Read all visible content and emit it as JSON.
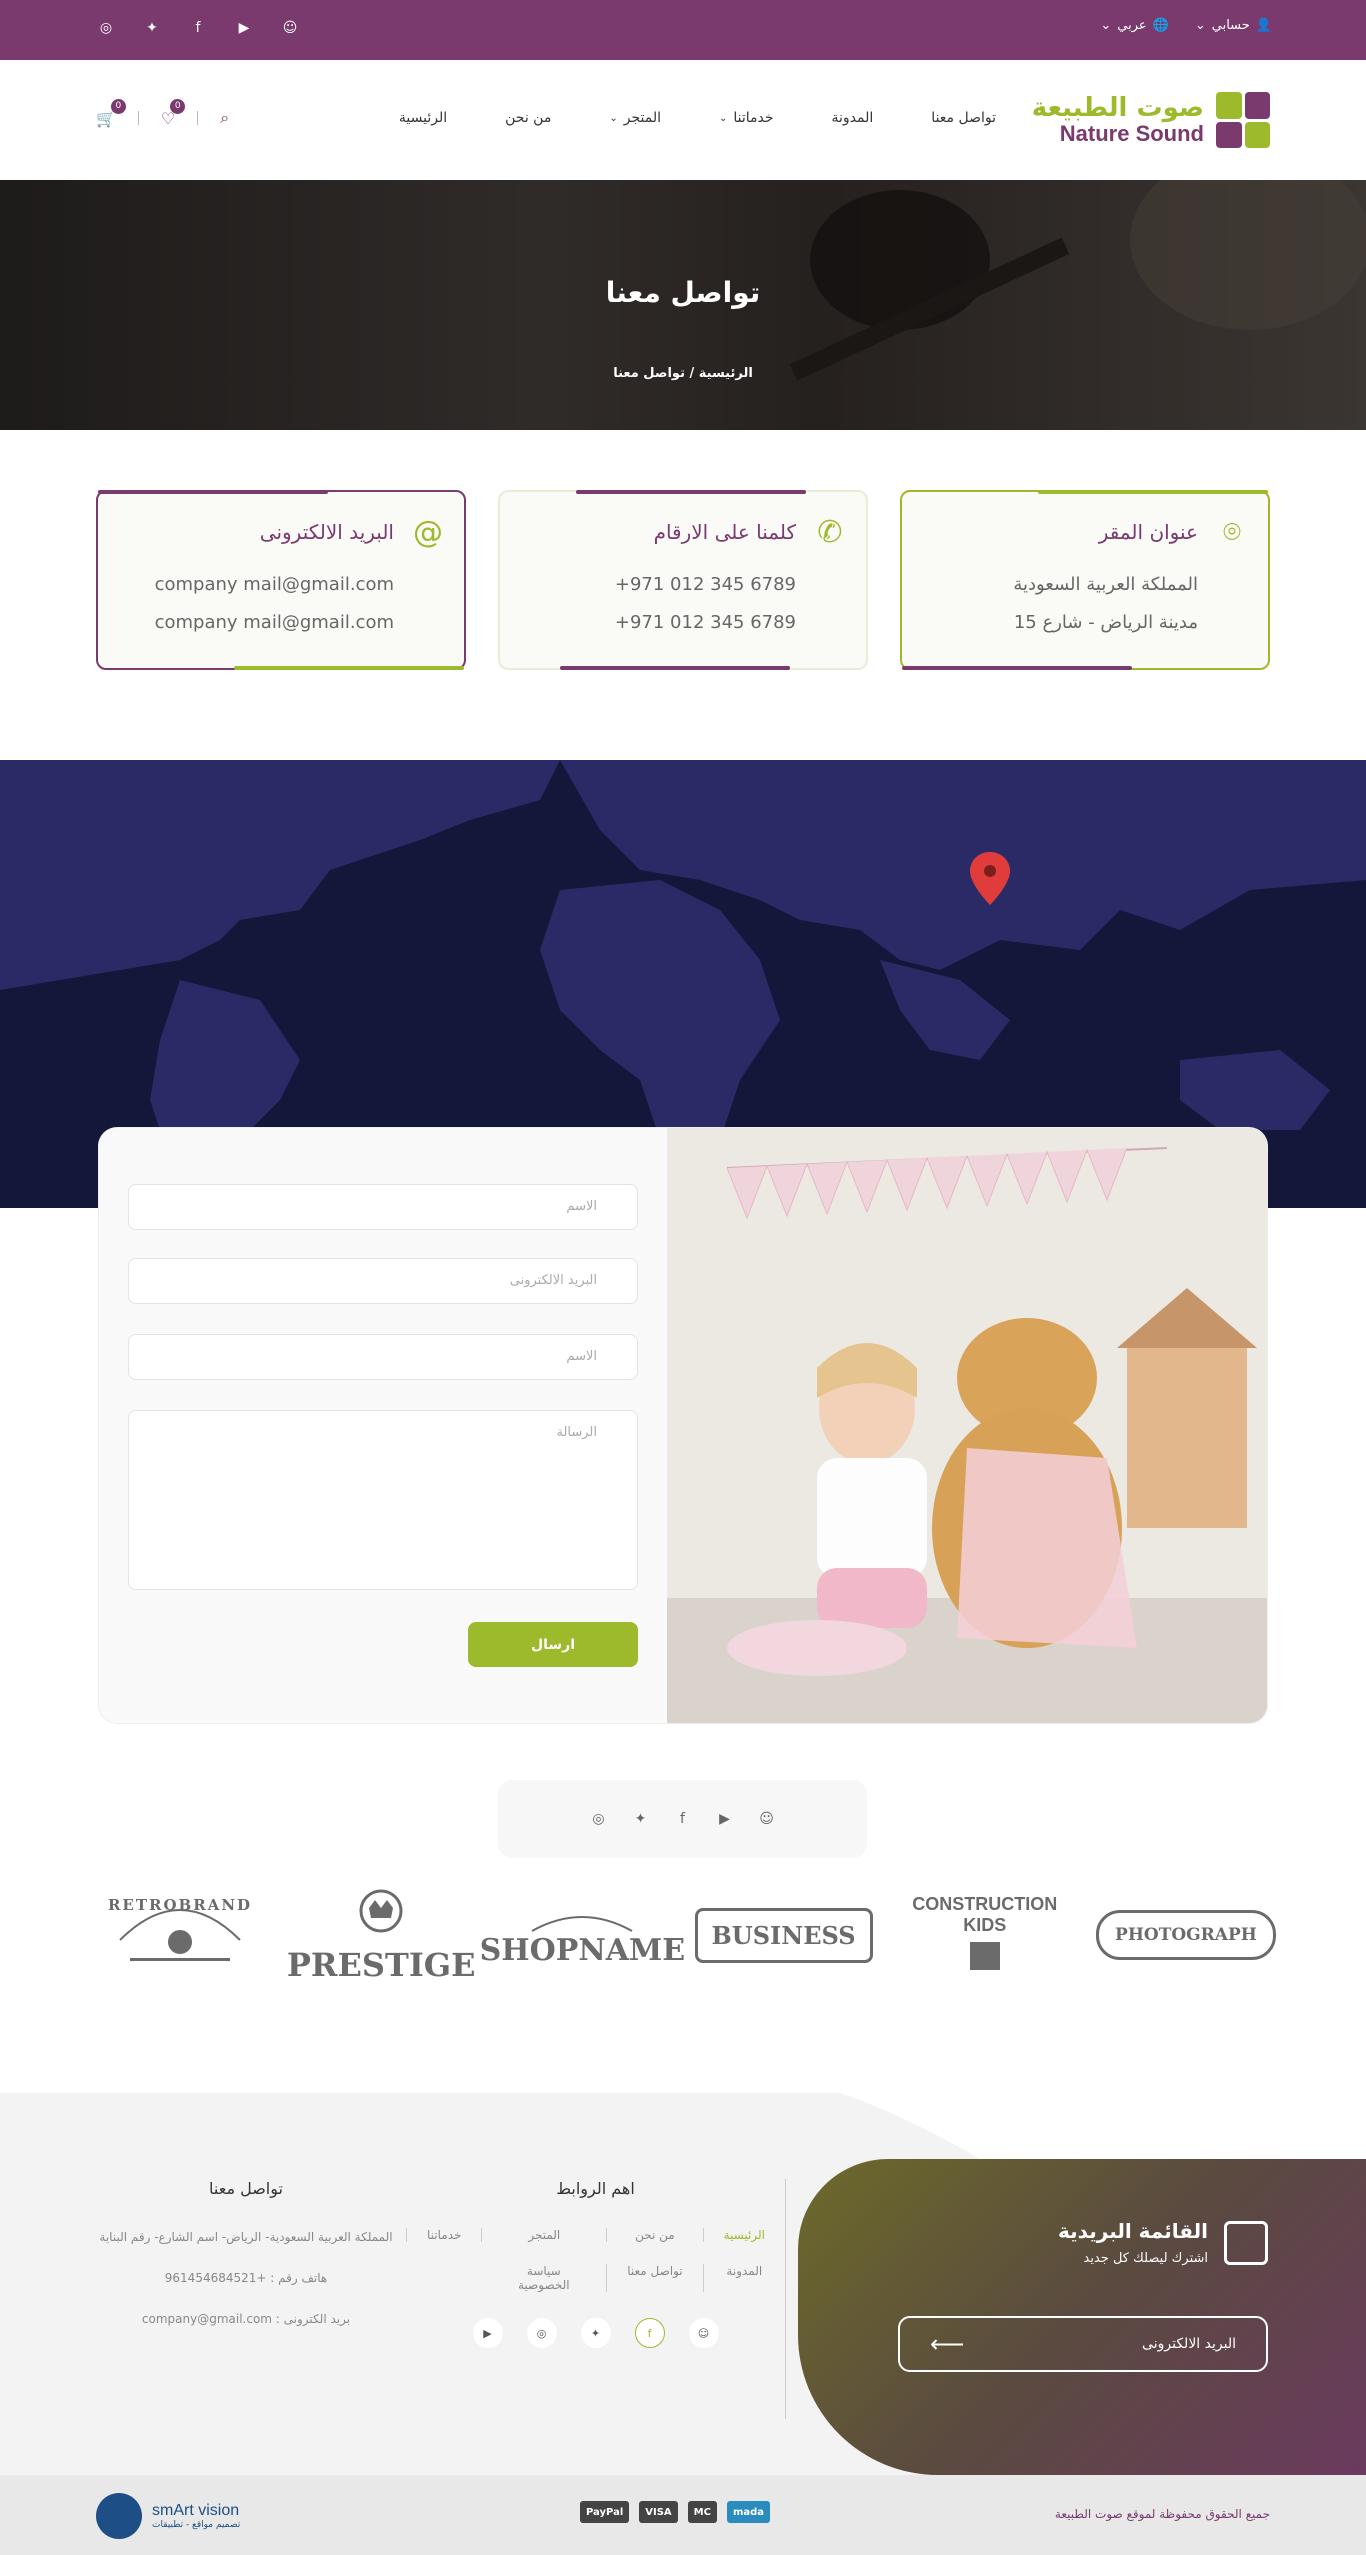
{
  "topbar": {
    "account_label": "حسابي",
    "language_label": "عربي",
    "socials": [
      "instagram-icon",
      "twitter-icon",
      "facebook-icon",
      "youtube-icon",
      "snapchat-icon"
    ]
  },
  "header": {
    "logo_ar": "صوت الطبيعة",
    "logo_en": "Nature Sound",
    "nav": [
      "الرئيسية",
      "من نحن",
      "المتجر",
      "خدماتنا",
      "المدونة",
      "تواصل معنا"
    ],
    "wishlist_count": "0",
    "cart_count": "0"
  },
  "hero": {
    "title": "تواصل معنا",
    "breadcrumb": "الرئيسية / تواصل معنا"
  },
  "cards": [
    {
      "title": "عنوان المقر",
      "line1": "المملكة العربية السعودية",
      "line2": "مدينة الرياض - شارع 15"
    },
    {
      "title": "كلمنا على الارقام",
      "line1": "+971 012 345 6789",
      "line2": "+971 012 345 6789"
    },
    {
      "title": "البريد الالكترونى",
      "line1": "company mail@gmail.com",
      "line2": "company mail@gmail.com"
    }
  ],
  "form": {
    "name_placeholder": "الاسم",
    "email_placeholder": "البريد الالكترونى",
    "name2_placeholder": "الاسم",
    "message_placeholder": "الرسالة",
    "submit_label": "ارسال"
  },
  "brands": [
    "PHOTOGRAPH",
    "CONSTRUCTION KIDS",
    "BUSINESS",
    "SHOPNAME",
    "PRESTIGE",
    "RETROBRAND"
  ],
  "footer": {
    "newsletter_title": "القائمة البريدية",
    "newsletter_sub": "اشترك ليصلك كل جديد",
    "newsletter_input": "البريد الالكترونى",
    "links_title": "اهم الروابط",
    "links": [
      "الرئيسية",
      "من نحن",
      "المتجر",
      "خدماتنا",
      "المدونة",
      "تواصل معنا",
      "سياسة الخصوصية"
    ],
    "contact_title": "تواصل معنا",
    "address": "المملكة العربية السعودية- الرياض- اسم الشارع- رقم البناية",
    "phone": "هاتف رقم : +961454684521",
    "email": "بريد الكترونى : company@gmail.com"
  },
  "bottom": {
    "copyright": "جميع الحقوق محفوظة لموقع صوت الطبيعة",
    "payments": [
      "PayPal",
      "VISA",
      "MC",
      "mada"
    ],
    "brand": "smArt vision",
    "brand_sub": "تصميم مواقع - تطبيقات"
  },
  "colors": {
    "primary": "#7a3a6e",
    "accent": "#9cba2b",
    "map": "#14163a"
  }
}
